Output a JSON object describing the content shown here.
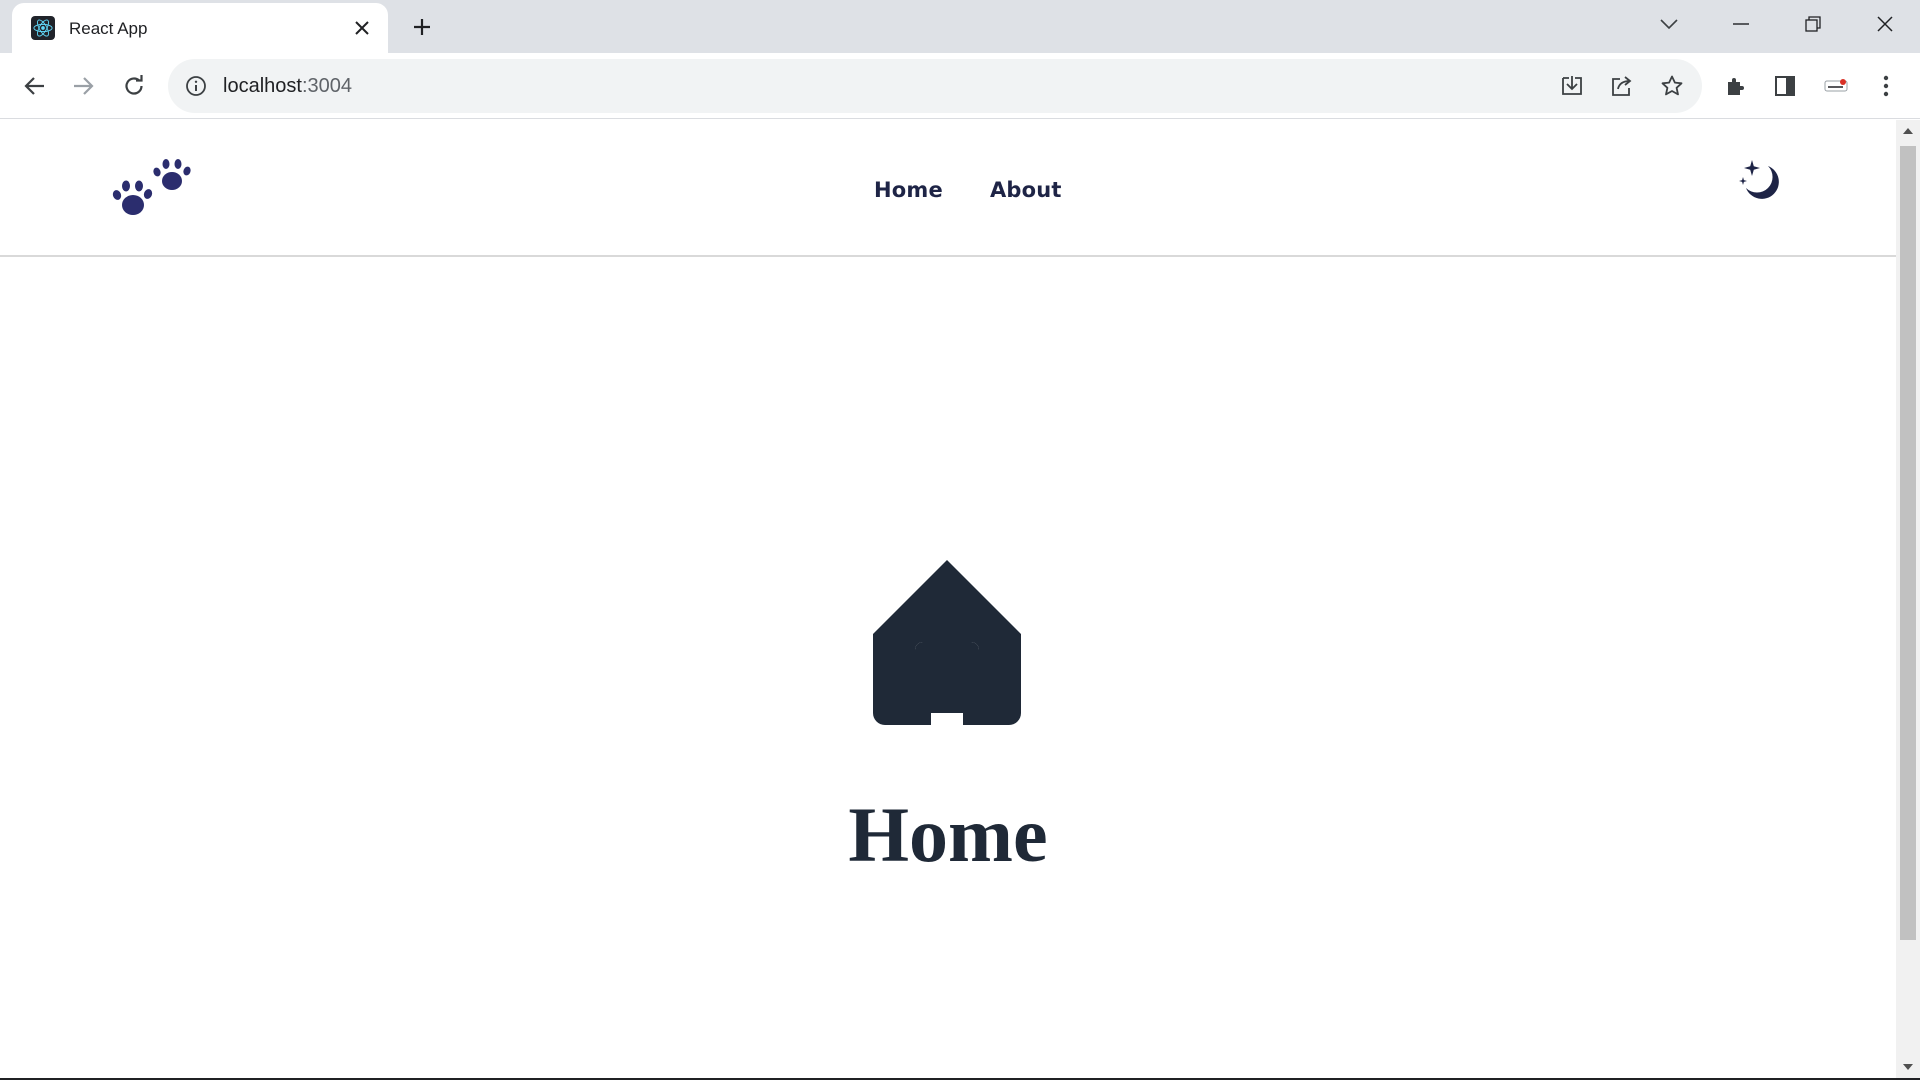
{
  "browser": {
    "tab": {
      "title": "React App",
      "favicon": "react-logo-icon"
    },
    "address": {
      "host": "localhost",
      "port": ":3004"
    },
    "colors": {
      "tabstrip": "#dee1e6",
      "omnibox": "#f1f3f4"
    }
  },
  "site": {
    "logo": "paw-prints-icon",
    "nav": [
      {
        "label": "Home"
      },
      {
        "label": "About"
      }
    ],
    "theme_toggle": "moon-stars-icon",
    "hero": {
      "icon": "home-icon",
      "title": "Home"
    },
    "colors": {
      "nav_text": "#1e2446",
      "icon": "#1f2937",
      "heading": "#1f2937"
    }
  }
}
